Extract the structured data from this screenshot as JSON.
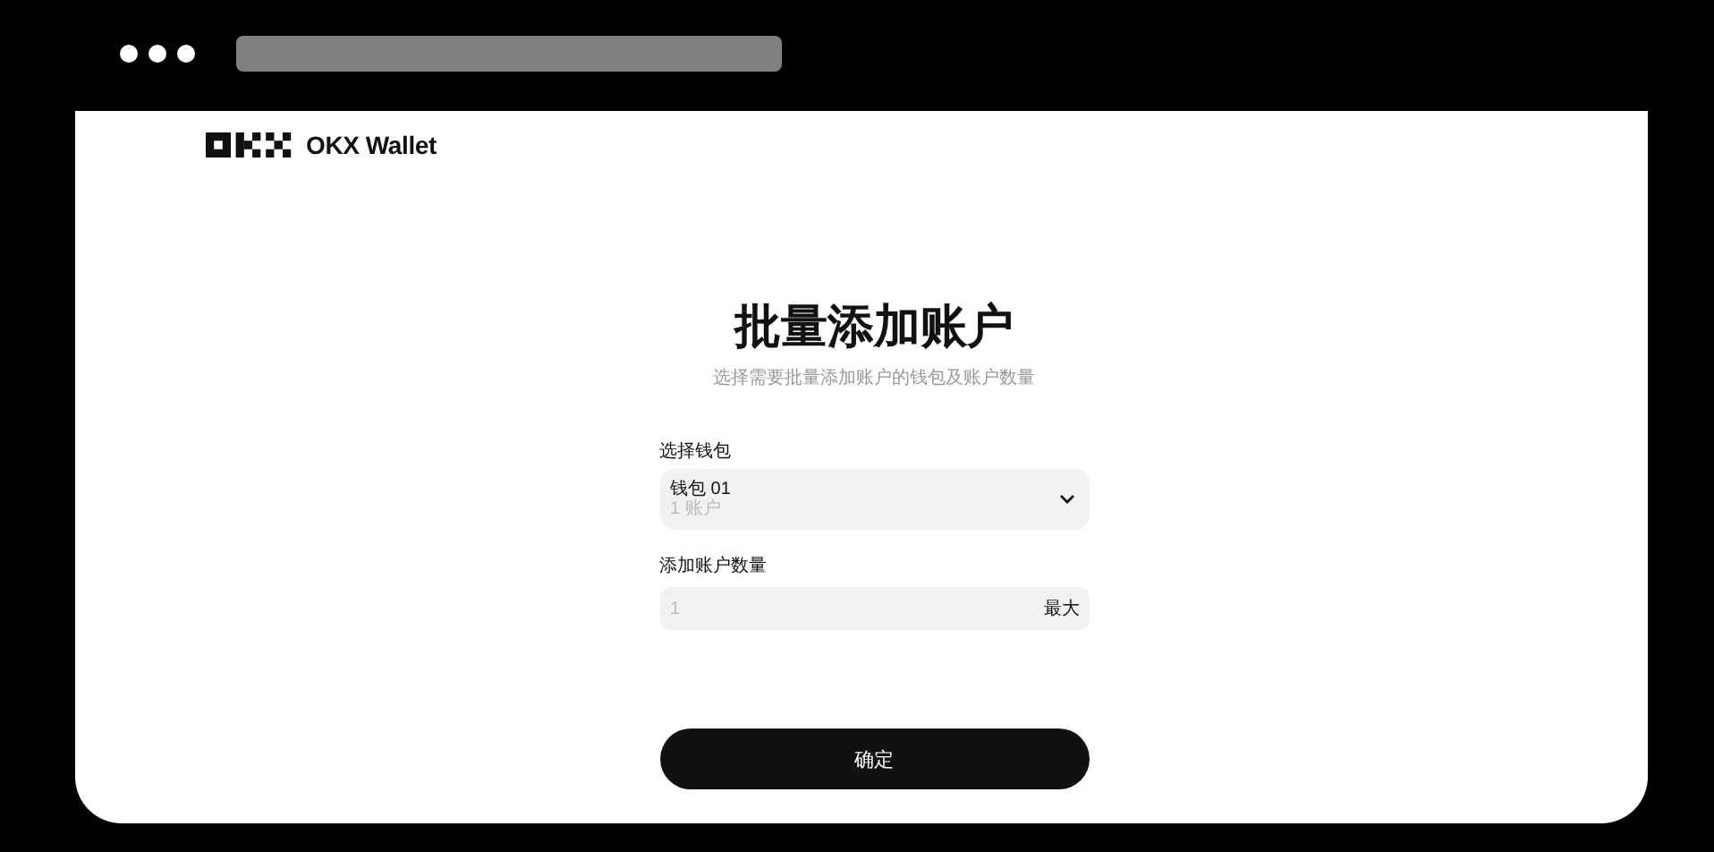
{
  "header": {
    "brand": "OKX Wallet"
  },
  "title": "批量添加账户",
  "subtitle": "选择需要批量添加账户的钱包及账户数量",
  "wallet_select": {
    "label": "选择钱包",
    "value": "钱包 01",
    "detail": "1 账户"
  },
  "quantity": {
    "label": "添加账户数量",
    "placeholder": "1",
    "max_button": "最大"
  },
  "confirm_button": "确定"
}
